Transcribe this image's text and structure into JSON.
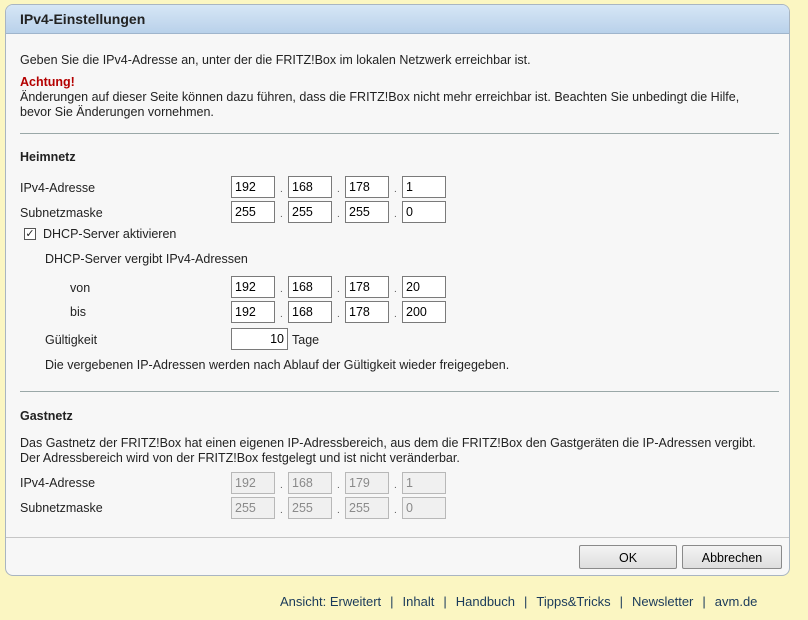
{
  "title": "IPv4-Einstellungen",
  "intro": "Geben Sie die IPv4-Adresse an, unter der die FRITZ!Box im lokalen Netzwerk erreichbar ist.",
  "warning_title": "Achtung!",
  "warning_line1": "Änderungen auf dieser Seite können dazu führen, dass die FRITZ!Box nicht mehr erreichbar ist. Beachten Sie unbedingt die Hilfe,",
  "warning_line2": "bevor Sie Änderungen vornehmen.",
  "heimnetz": {
    "title": "Heimnetz",
    "ipv4_label": "IPv4-Adresse",
    "ipv4": [
      "192",
      "168",
      "178",
      "1"
    ],
    "subnet_label": "Subnetzmaske",
    "subnet": [
      "255",
      "255",
      "255",
      "0"
    ],
    "dhcp_label": "DHCP-Server aktivieren",
    "dhcp_checked": "✓",
    "dhcp_range_label": "DHCP-Server vergibt IPv4-Adressen",
    "von_label": "von",
    "von": [
      "192",
      "168",
      "178",
      "20"
    ],
    "bis_label": "bis",
    "bis": [
      "192",
      "168",
      "178",
      "200"
    ],
    "validity_label": "Gültigkeit",
    "validity_value": "10",
    "validity_unit": "Tage",
    "note": "Die vergebenen IP-Adressen werden nach Ablauf der Gültigkeit wieder freigegeben."
  },
  "gastnetz": {
    "title": "Gastnetz",
    "desc_line1": "Das Gastnetz der FRITZ!Box hat einen eigenen IP-Adressbereich, aus dem die FRITZ!Box den Gastgeräten die IP-Adressen vergibt.",
    "desc_line2": "Der Adressbereich wird von der FRITZ!Box festgelegt und ist nicht veränderbar.",
    "ipv4_label": "IPv4-Adresse",
    "ipv4": [
      "192",
      "168",
      "179",
      "1"
    ],
    "subnet_label": "Subnetzmaske",
    "subnet": [
      "255",
      "255",
      "255",
      "0"
    ]
  },
  "buttons": {
    "ok": "OK",
    "cancel": "Abbrechen"
  },
  "footer_links": [
    "Ansicht: Erweitert",
    "Inhalt",
    "Handbuch",
    "Tipps&Tricks",
    "Newsletter",
    "avm.de"
  ],
  "separator": "|",
  "dot": "."
}
